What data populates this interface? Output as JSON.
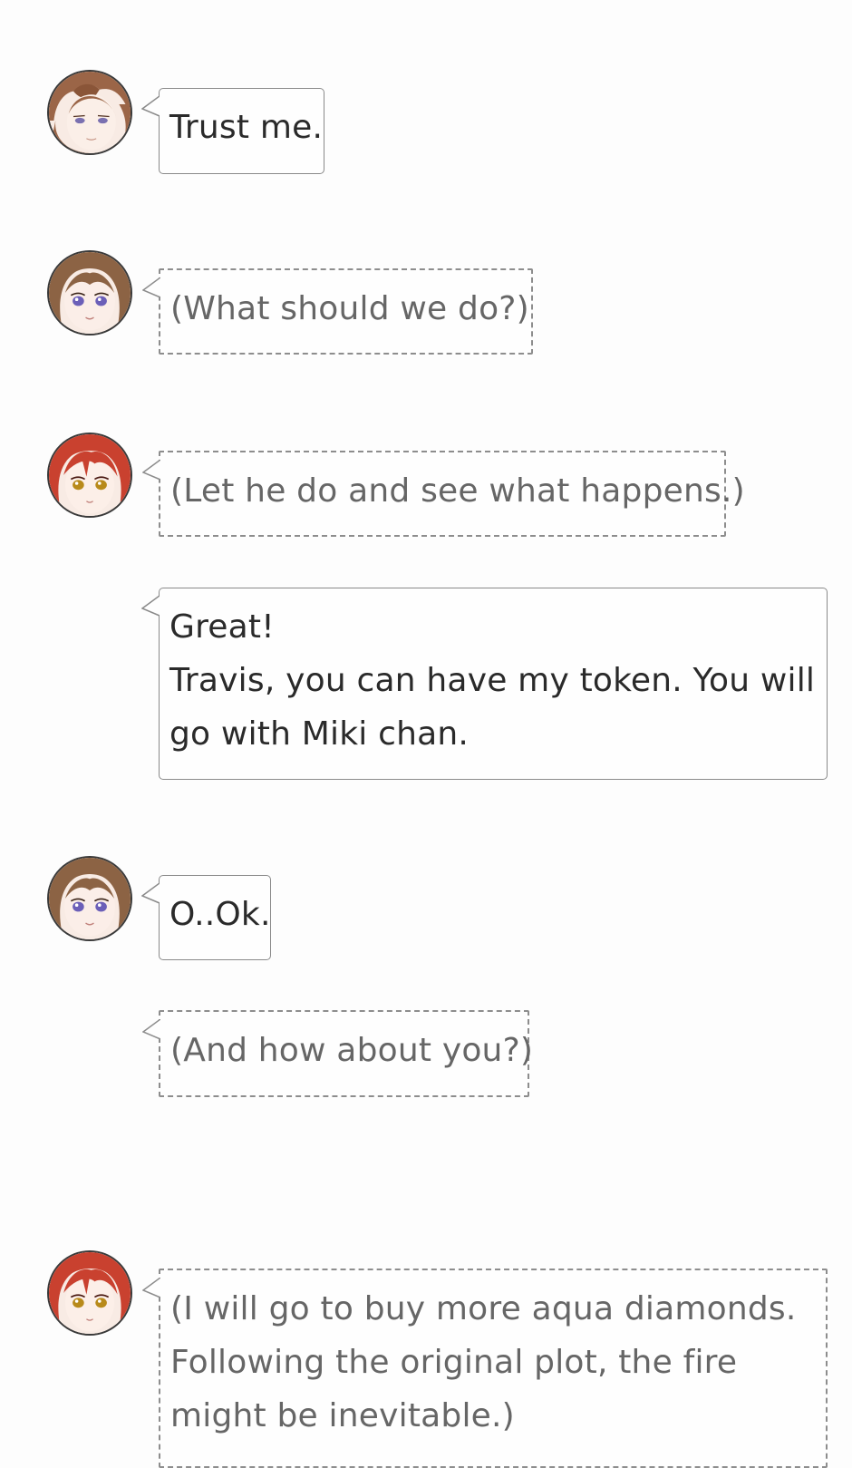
{
  "conversation": {
    "messages": [
      {
        "type": "speech",
        "avatar": "brown-haired-boy-icon",
        "lines": [
          "Trust me."
        ]
      },
      {
        "type": "thought",
        "avatar": "brown-haired-girl-icon",
        "lines": [
          "(What should we do?)"
        ]
      },
      {
        "type": "thought",
        "avatar": "red-haired-girl-icon",
        "lines": [
          "(Let he do and see what happens.)"
        ]
      },
      {
        "type": "speech",
        "avatar": "none",
        "lines": [
          "Great!",
          "Travis, you can have my token. You will",
          "go with Miki chan."
        ]
      },
      {
        "type": "speech",
        "avatar": "brown-haired-girl-icon",
        "lines": [
          "O..Ok."
        ]
      },
      {
        "type": "thought",
        "avatar": "none",
        "lines": [
          "(And how about you?)"
        ]
      },
      {
        "type": "thought",
        "avatar": "red-haired-girl-icon",
        "lines": [
          "(I will go to buy more aqua diamonds.",
          "Following the original plot, the fire",
          "might be inevitable.)"
        ]
      }
    ]
  },
  "colors": {
    "speech_border": "#8a8a8a",
    "thought_border": "#8d8d8d",
    "speech_text": "#2a2a2a",
    "thought_text": "#666666",
    "background": "#fdfdfd"
  }
}
